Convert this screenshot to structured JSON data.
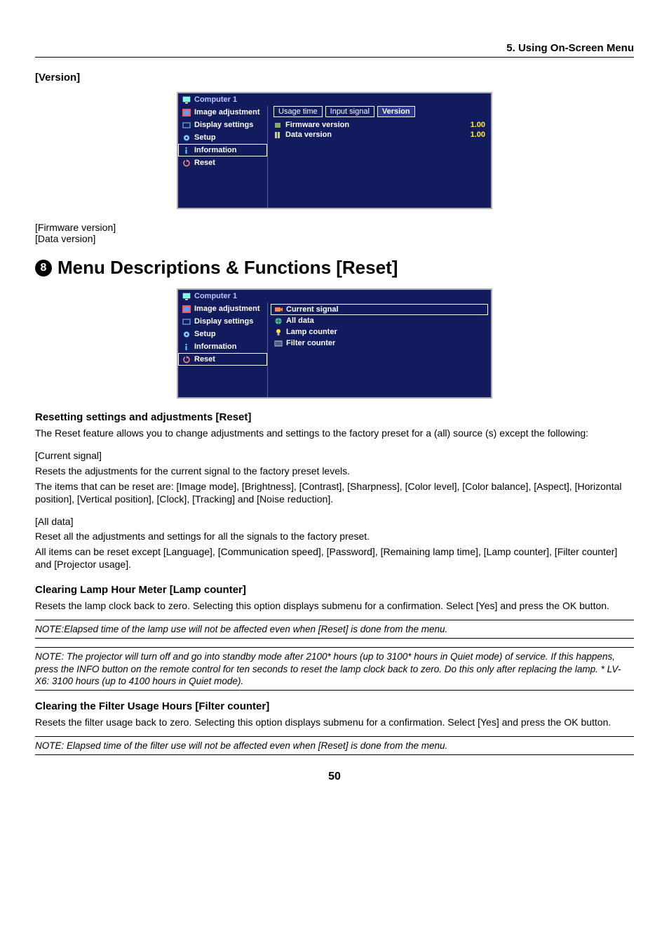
{
  "header": {
    "chapter": "5. Using On-Screen Menu"
  },
  "versionSection": {
    "label": "[Version]",
    "menu": {
      "title": "Computer 1",
      "sidebar": [
        {
          "label": "Image adjustment"
        },
        {
          "label": "Display settings"
        },
        {
          "label": "Setup"
        },
        {
          "label": "Information",
          "selected": true
        },
        {
          "label": "Reset"
        }
      ],
      "tabs": [
        {
          "label": "Usage time"
        },
        {
          "label": "Input signal"
        },
        {
          "label": "Version",
          "active": true
        }
      ],
      "items": [
        {
          "k": "Firmware version",
          "v": "1.00"
        },
        {
          "k": "Data version",
          "v": "1.00"
        }
      ]
    },
    "belowList": [
      "[Firmware version]",
      "[Data version]"
    ]
  },
  "resetSection": {
    "num": "8",
    "title": "Menu Descriptions & Functions [Reset]",
    "menu": {
      "title": "Computer 1",
      "sidebar": [
        {
          "label": "Image adjustment"
        },
        {
          "label": "Display settings"
        },
        {
          "label": "Setup"
        },
        {
          "label": "Information"
        },
        {
          "label": "Reset",
          "selected": true
        }
      ],
      "list": [
        {
          "label": "Current signal",
          "sel": true
        },
        {
          "label": "All data"
        },
        {
          "label": "Lamp counter"
        },
        {
          "label": "Filter counter"
        }
      ]
    },
    "sub1": {
      "heading": "Resetting settings and adjustments [Reset]",
      "intro": "The Reset feature allows you to change adjustments and settings to the factory preset for a (all) source (s) except the following:",
      "cs_label": "[Current signal]",
      "cs_l1": "Resets the adjustments for the current signal to the factory preset levels.",
      "cs_l2": "The items that can be reset are: [Image mode], [Brightness], [Contrast], [Sharpness], [Color level], [Color balance], [Aspect],  [Horizontal position], [Vertical position], [Clock], [Tracking] and [Noise reduction].",
      "ad_label": "[All data]",
      "ad_l1": "Reset all the adjustments and settings for all the signals to the factory preset.",
      "ad_l2": "All items can be reset except [Language], [Communication speed], [Password], [Remaining lamp time], [Lamp counter], [Filter counter] and [Projector usage]."
    },
    "sub2": {
      "heading": "Clearing Lamp Hour Meter [Lamp counter]",
      "p": "Resets the lamp clock back to zero. Selecting this option displays submenu for a confirmation. Select [Yes] and press the OK button.",
      "note1": "NOTE:Elapsed time of the lamp use will not be affected even when [Reset] is done from the menu.",
      "note2": "NOTE: The projector will turn off and go into standby mode after 2100* hours (up to 3100* hours in Quiet mode) of service. If this happens, press the INFO button on the remote control for ten seconds to reset the lamp clock back to zero. Do this only after replacing the lamp. * LV-X6: 3100 hours (up to 4100 hours in Quiet mode)."
    },
    "sub3": {
      "heading": "Clearing the Filter Usage Hours [Filter counter]",
      "p": "Resets the filter usage back to zero. Selecting this option displays submenu for a confirmation. Select [Yes] and press the OK button.",
      "note": "NOTE: Elapsed time of the filter use will not be affected even when [Reset] is done from the menu."
    }
  },
  "pageNumber": "50",
  "icons": {
    "computer": "computer-icon",
    "imageadj": "preset-icon",
    "display": "display-icon",
    "setup": "setup-icon",
    "info": "info-icon",
    "reset": "reset-icon",
    "firm": "chip-icon",
    "data": "data-icon",
    "current": "signal-icon",
    "all": "globe-icon",
    "lamp": "lamp-icon",
    "filter": "filter-icon"
  }
}
